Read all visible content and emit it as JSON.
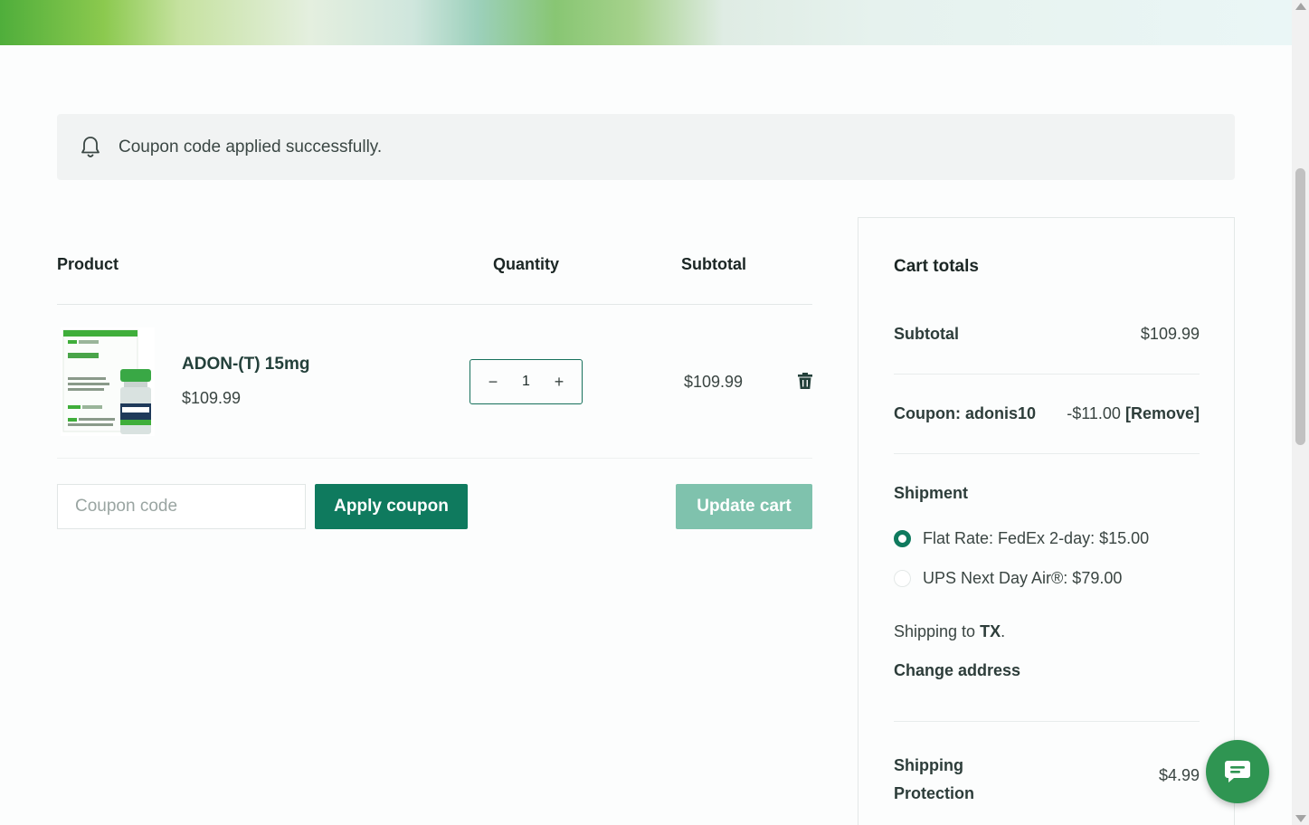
{
  "notice": {
    "icon": "bell-icon",
    "message": "Coupon code applied successfully."
  },
  "table": {
    "headers": {
      "product": "Product",
      "quantity": "Quantity",
      "subtotal": "Subtotal"
    },
    "rows": [
      {
        "name": "ADON-(T) 15mg",
        "price": "$109.99",
        "quantity": "1",
        "subtotal": "$109.99"
      }
    ]
  },
  "coupon": {
    "placeholder": "Coupon code",
    "value": "",
    "apply_label": "Apply coupon"
  },
  "update_label": "Update cart",
  "totals": {
    "title": "Cart totals",
    "subtotal_label": "Subtotal",
    "subtotal_value": "$109.99",
    "coupon_label": "Coupon: adonis10",
    "coupon_value": "-$11.00",
    "coupon_remove": "[Remove]",
    "shipment_label": "Shipment",
    "shipping_options": [
      {
        "label": "Flat Rate: FedEx 2-day: $15.00",
        "selected": true
      },
      {
        "label": "UPS Next Day Air®: $79.00",
        "selected": false
      }
    ],
    "shipping_to_prefix": "Shipping to",
    "shipping_to_state": "TX",
    "shipping_to_suffix": ".",
    "change_address": "Change address",
    "protection_label": "Shipping Protection",
    "protection_value": "$4.99"
  },
  "colors": {
    "primary": "#0f7a5e",
    "primary_disabled": "#7fc2ad",
    "chat": "#2f9552"
  }
}
